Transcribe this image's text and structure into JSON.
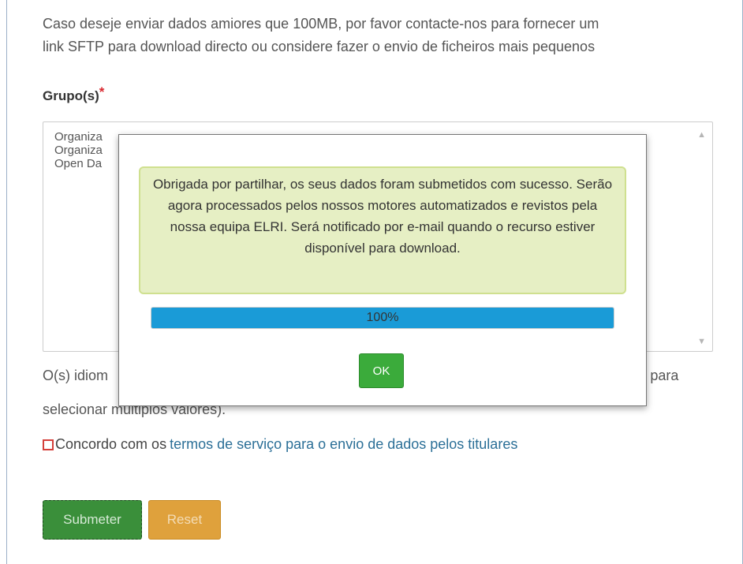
{
  "intro": {
    "line1": "Caso deseje enviar dados amiores que 100MB, por favor contacte-nos para fornecer um",
    "line2": "link SFTP para download directo ou considere fazer o envio de ficheiros mais pequenos"
  },
  "groups": {
    "label": "Grupo(s)",
    "required_mark": "*",
    "items": [
      "Organiza",
      "Organiza",
      "Open Da"
    ]
  },
  "help": {
    "line1_start": "O(s) idiom",
    "line1_end": "L para",
    "line2": "selecionar múltiplos valores)."
  },
  "terms": {
    "prefix": "Concordo com os",
    "link": "termos de serviço para o envio de dados pelos titulares"
  },
  "buttons": {
    "submit": "Submeter",
    "reset": "Reset"
  },
  "modal": {
    "message": "Obrigada por partilhar, os seus dados foram submetidos com sucesso. Serão agora processados pelos nossos motores automatizados e revistos pela nossa equipa ELRI. Será notificado por e-mail quando o recurso estiver disponível para download.",
    "progress_percent": 100,
    "progress_label": "100%",
    "ok_label": "OK"
  },
  "colors": {
    "success_bg": "#e6efc4",
    "progress": "#1a9bd7",
    "submit": "#3a8f3a",
    "reset": "#dfa13c",
    "link": "#2b6f97"
  }
}
